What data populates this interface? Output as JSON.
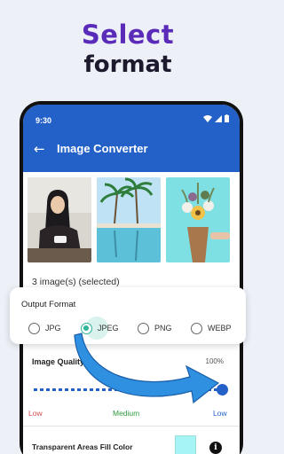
{
  "headline": {
    "line1": "Select",
    "line2": "format"
  },
  "status_bar": {
    "time": "9:30"
  },
  "toolbar": {
    "title": "Image Converter",
    "back_glyph": "←"
  },
  "images": [
    {
      "name": "photo-woman-with-cup"
    },
    {
      "name": "photo-palm-pool"
    },
    {
      "name": "photo-flower-bouquet"
    }
  ],
  "selection": {
    "count_text": "3 image(s) (selected)"
  },
  "output_format": {
    "title": "Output Format",
    "options": [
      {
        "label": "JPG",
        "checked": false
      },
      {
        "label": "JPEG",
        "checked": true
      },
      {
        "label": "PNG",
        "checked": false
      },
      {
        "label": "WEBP",
        "checked": false
      }
    ]
  },
  "quality": {
    "label": "Image Quality",
    "value_text": "100%",
    "level": 1.0,
    "levels": {
      "low": "Low",
      "medium": "Medium",
      "high": "Low"
    }
  },
  "fill": {
    "label": "Transparent Areas Fill Color",
    "color": "#a6f4f4",
    "info_glyph": "i"
  },
  "colors": {
    "accent": "#2361c9",
    "headline_purple": "#5a2bb8",
    "radio_selected": "#2eb59a",
    "low": "#d24c4c",
    "medium": "#2d9b3c"
  }
}
